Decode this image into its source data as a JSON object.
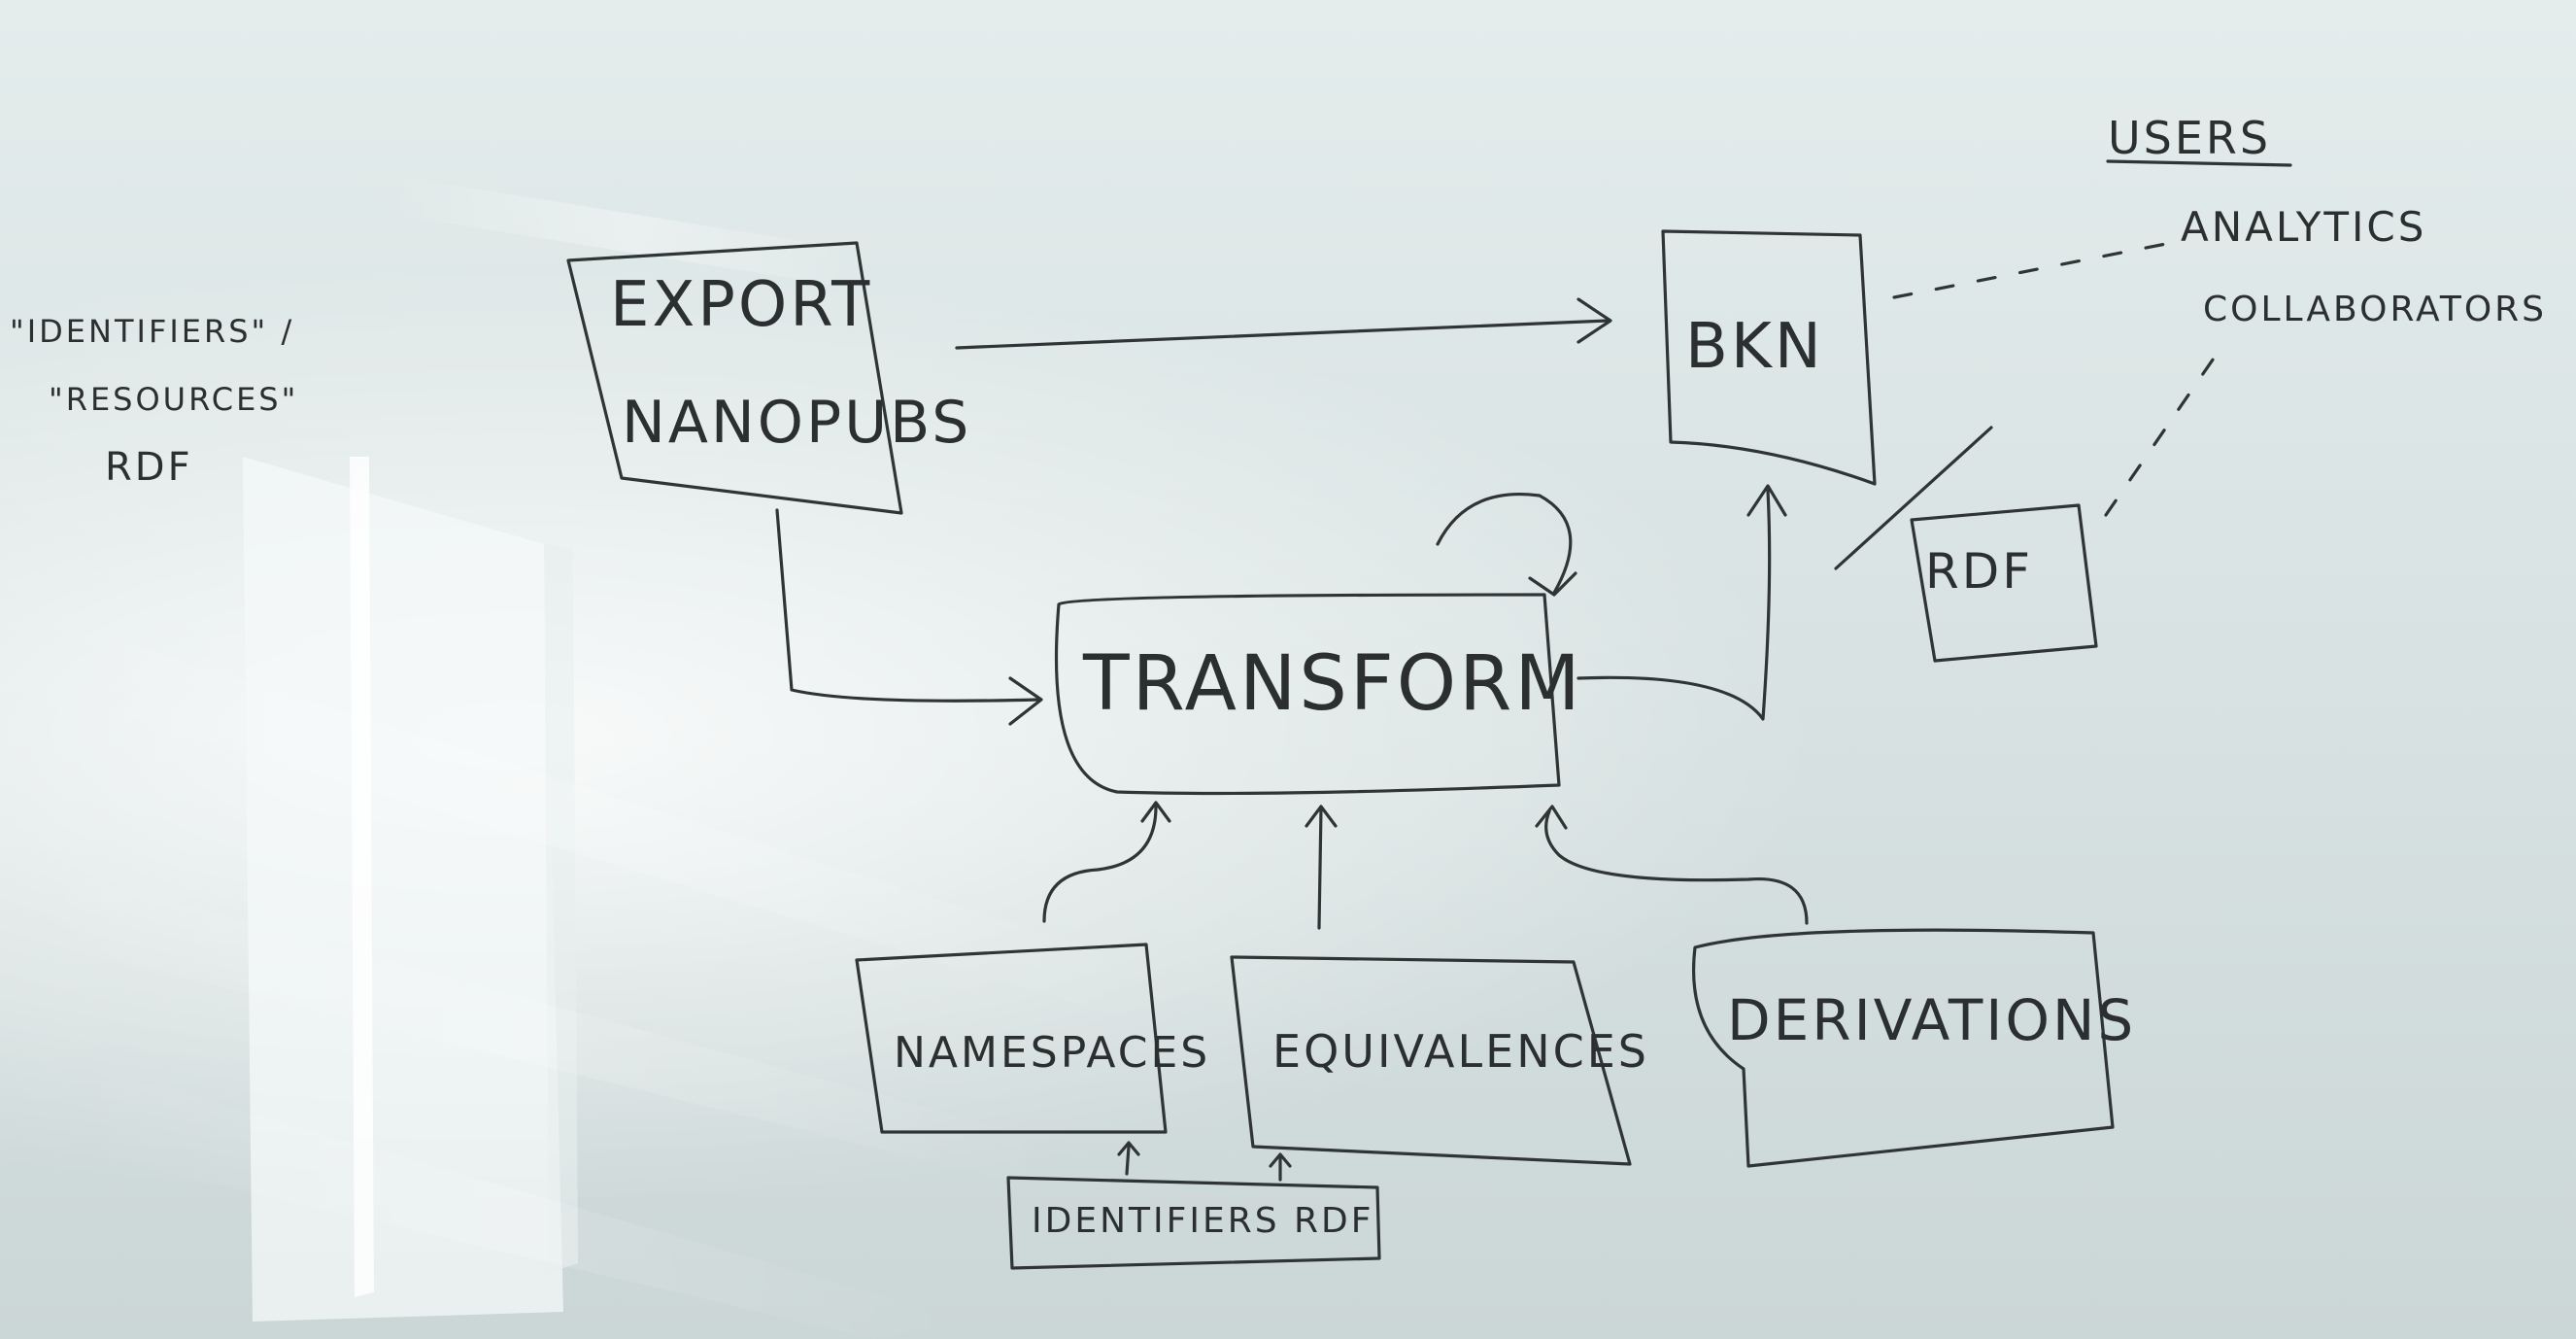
{
  "labels": {
    "export": "EXPORT",
    "nanopubs": "NANOPUBS",
    "bkn": "BKN",
    "transform": "TRANSFORM",
    "namespaces": "NAMESPACES",
    "equivalences": "EQUIVALENCES",
    "derivations": "DERIVATIONS",
    "identifiers_rdf": "IDENTIFIERS   RDF",
    "rdf": "RDF",
    "users": "USERS",
    "analytics": "ANALYTICS",
    "collaborators": "COLLABORATORS",
    "note_identifiers": "\"IDENTIFIERS\" /",
    "note_resources": "\"RESOURCES\"",
    "note_rdf": "RDF"
  }
}
